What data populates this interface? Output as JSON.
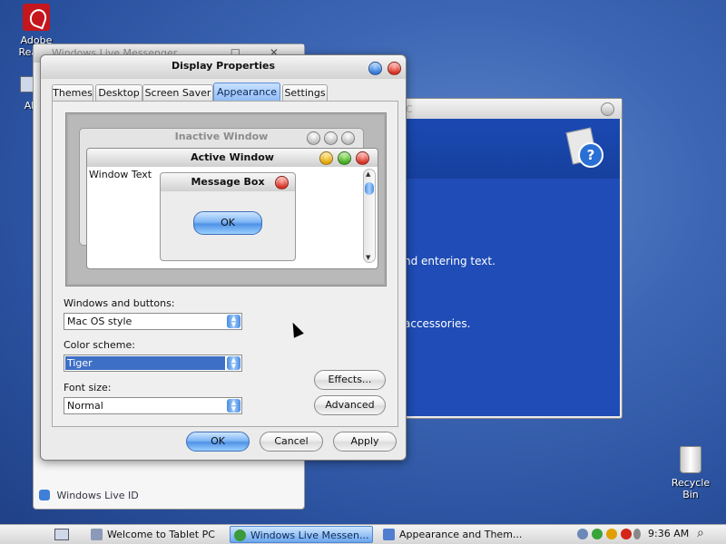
{
  "desktop": {
    "adobe_label": "Adobe Reader",
    "second_icon_label": "Al",
    "recycle_label": "Recycle Bin"
  },
  "bg_messenger": {
    "title": "Windows Live Messenger",
    "footer": "Windows Live ID"
  },
  "welcome_window": {
    "title_fragment": "C",
    "line1": "nd entering text.",
    "line2": "accessories."
  },
  "dialog": {
    "title": "Display Properties",
    "tabs": [
      "Themes",
      "Desktop",
      "Screen Saver",
      "Appearance",
      "Settings"
    ],
    "active_tab": "Appearance",
    "preview": {
      "inactive_title": "Inactive Window",
      "active_title": "Active Window",
      "window_text": "Window Text",
      "msgbox_title": "Message Box",
      "ok": "OK"
    },
    "windows_buttons_label": "Windows and buttons:",
    "windows_buttons_value": "Mac OS style",
    "color_scheme_label": "Color scheme:",
    "color_scheme_value": "Tiger",
    "font_size_label": "Font size:",
    "font_size_value": "Normal",
    "effects": "Effects...",
    "advanced": "Advanced",
    "ok": "OK",
    "cancel": "Cancel",
    "apply": "Apply"
  },
  "taskbar": {
    "items": [
      "Welcome to Tablet PC",
      "Windows Live Messen...",
      "Appearance and Them..."
    ],
    "active_index": 1,
    "clock": "9:36 AM"
  },
  "colors": {
    "accent_blue": "#4f92e6",
    "selection": "#3d6fc6",
    "close_red": "#d32518"
  }
}
